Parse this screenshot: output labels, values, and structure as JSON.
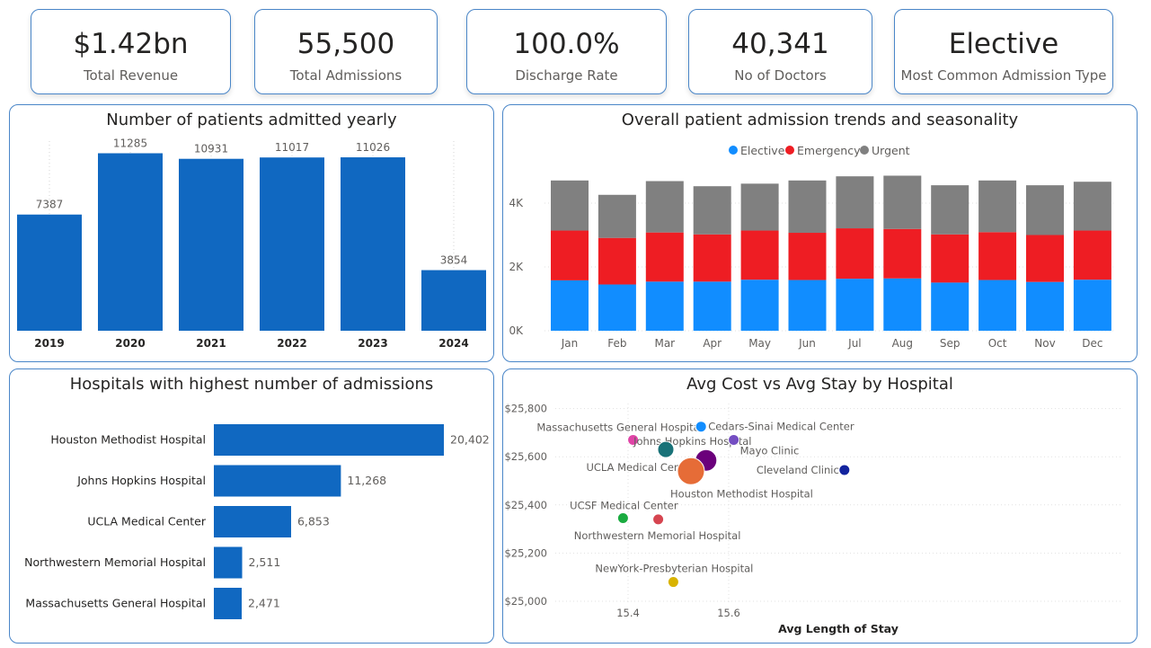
{
  "kpis": [
    {
      "value": "$1.42bn",
      "label": "Total Revenue"
    },
    {
      "value": "55,500",
      "label": "Total Admissions"
    },
    {
      "value": "100.0%",
      "label": "Discharge Rate"
    },
    {
      "value": "40,341",
      "label": "No of Doctors"
    },
    {
      "value": "Elective",
      "label": "Most Common Admission Type"
    }
  ],
  "colors": {
    "bar_blue": "#1068c1",
    "elective": "#118dff",
    "emergency": "#ee1d23",
    "urgent": "#808080",
    "border": "#4a86c8"
  },
  "chart_data": [
    {
      "type": "bar",
      "title": "Number of patients admitted yearly",
      "categories": [
        "2019",
        "2020",
        "2021",
        "2022",
        "2023",
        "2024"
      ],
      "values": [
        7387,
        11285,
        10931,
        11017,
        11026,
        3854
      ]
    },
    {
      "type": "bar",
      "title": "Overall patient admission trends and seasonality",
      "stacked": true,
      "legend_position": "top-center",
      "categories": [
        "Jan",
        "Feb",
        "Mar",
        "Apr",
        "May",
        "Jun",
        "Jul",
        "Aug",
        "Sep",
        "Oct",
        "Nov",
        "Dec"
      ],
      "y_ticks": [
        "0K",
        "2K",
        "4K"
      ],
      "ylim": [
        0,
        5000
      ],
      "series": [
        {
          "name": "Elective",
          "values": [
            1580,
            1450,
            1540,
            1540,
            1600,
            1590,
            1630,
            1640,
            1510,
            1590,
            1530,
            1600
          ]
        },
        {
          "name": "Emergency",
          "values": [
            1560,
            1460,
            1540,
            1480,
            1540,
            1480,
            1580,
            1550,
            1510,
            1500,
            1470,
            1540
          ]
        },
        {
          "name": "Urgent",
          "values": [
            1570,
            1350,
            1610,
            1510,
            1470,
            1640,
            1630,
            1670,
            1540,
            1620,
            1560,
            1530
          ]
        }
      ]
    },
    {
      "type": "bar",
      "orientation": "horizontal",
      "title": "Hospitals with highest number of admissions",
      "categories": [
        "Houston Methodist Hospital",
        "Johns Hopkins Hospital",
        "UCLA Medical Center",
        "Northwestern Memorial Hospital",
        "Massachusetts General Hospital"
      ],
      "values": [
        20402,
        11268,
        6853,
        2511,
        2471
      ],
      "value_labels": [
        "20,402",
        "11,268",
        "6,853",
        "2,511",
        "2,471"
      ]
    },
    {
      "type": "scatter",
      "title": "Avg Cost vs Avg Stay by Hospital",
      "xlabel": "Avg Length of Stay",
      "ylabel": "",
      "x_ticks": [
        "15.4",
        "15.6"
      ],
      "y_ticks": [
        "$25,000",
        "$25,200",
        "$25,400",
        "$25,600",
        "$25,800"
      ],
      "xlim": [
        15.32,
        15.83
      ],
      "ylim": [
        24985,
        25810
      ],
      "grid": true,
      "points": [
        {
          "name": "Massachusetts General Hospital",
          "x": 15.41,
          "y": 25670,
          "size": 6,
          "color": "#e044a7"
        },
        {
          "name": "Cedars-Sinai Medical Center",
          "x": 15.545,
          "y": 25725,
          "size": 6,
          "color": "#118dff"
        },
        {
          "name": "Johns Hopkins Hospital",
          "x": 15.555,
          "y": 25585,
          "size": 12,
          "color": "#6b007b"
        },
        {
          "name": "Mayo Clinic",
          "x": 15.61,
          "y": 25670,
          "size": 6,
          "color": "#744ec2"
        },
        {
          "name": "UCLA Medical Center",
          "x": 15.475,
          "y": 25630,
          "size": 9,
          "color": "#197278"
        },
        {
          "name": "Houston Methodist Hospital",
          "x": 15.525,
          "y": 25540,
          "size": 15,
          "color": "#e66c37"
        },
        {
          "name": "Cleveland Clinic",
          "x": 15.83,
          "y": 25545,
          "size": 6,
          "color": "#12239e"
        },
        {
          "name": "UCSF Medical Center",
          "x": 15.39,
          "y": 25345,
          "size": 6,
          "color": "#1aab40"
        },
        {
          "name": "Northwestern Memorial Hospital",
          "x": 15.46,
          "y": 25340,
          "size": 6,
          "color": "#d64550"
        },
        {
          "name": "NewYork-Presbyterian Hospital",
          "x": 15.49,
          "y": 25080,
          "size": 6,
          "color": "#d9b300"
        }
      ]
    }
  ]
}
